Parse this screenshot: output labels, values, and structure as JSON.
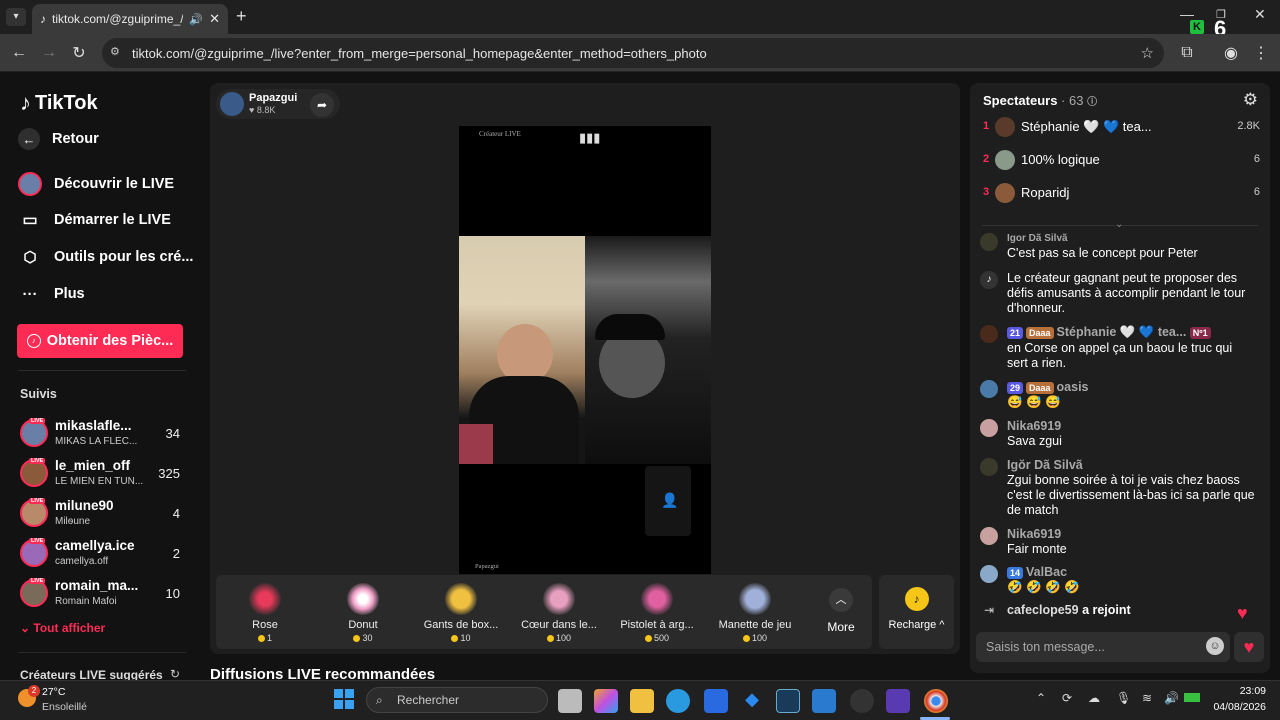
{
  "browser": {
    "tab_title": "tiktok.com/@zguiprime_/live",
    "url": "tiktok.com/@zguiprime_/live?enter_from_merge=personal_homepage&enter_method=others_photo",
    "overlay_number": "6"
  },
  "sidebar": {
    "logo": "TikTok",
    "back": "Retour",
    "nav": [
      "Découvrir le LIVE",
      "Démarrer le LIVE",
      "Outils pour les cré...",
      "Plus"
    ],
    "coin_button": "Obtenir des Pièc...",
    "following_title": "Suivis",
    "live_label": "LIVE",
    "following": [
      {
        "name": "mikaslafle...",
        "sub": "MIKAS LA FLÈC...",
        "count": "34",
        "color": "#6a7fa8"
      },
      {
        "name": "le_mien_off",
        "sub": "LE MIEN EN TUN...",
        "count": "325",
        "color": "#8a5a3a"
      },
      {
        "name": "milune90",
        "sub": "Milѳune",
        "count": "4",
        "color": "#b88a6a"
      },
      {
        "name": "camellya.ice",
        "sub": "camellya.off",
        "count": "2",
        "color": "#9a6ab8"
      },
      {
        "name": "romain_ma...",
        "sub": "Romain Mafoi",
        "count": "10",
        "color": "#7a6a5a"
      }
    ],
    "show_all": "Tout afficher",
    "suggested_title": "Créateurs LIVE suggérés"
  },
  "main": {
    "host_name": "Papazgui",
    "host_likes": "8.8K",
    "video_top_label": "Créateur LIVE",
    "video_bottom_label": "Papazgui",
    "gifts": [
      {
        "name": "Rose",
        "price": "1",
        "color": "#d4204a"
      },
      {
        "name": "Donut",
        "price": "30",
        "color": "#f0a0c8"
      },
      {
        "name": "Gants de box...",
        "price": "10",
        "color": "#f0c040"
      },
      {
        "name": "Cœur dans le...",
        "price": "100",
        "color": "#e8a0c0"
      },
      {
        "name": "Pistolet à arg...",
        "price": "500",
        "color": "#e060a0"
      },
      {
        "name": "Manette de jeu",
        "price": "100",
        "color": "#a0b0d8"
      }
    ],
    "more_label": "More",
    "recharge_label": "Recharge",
    "section_title": "Diffusions LIVE recommandées"
  },
  "chat": {
    "title": "Spectateurs",
    "viewer_count": "· 63",
    "ranking": [
      {
        "rank": "1",
        "name": "Stéphanie 🤍 💙 tea...",
        "value": "2.8K",
        "color": "#5a3a2a"
      },
      {
        "rank": "2",
        "name": "100% logique",
        "value": "6",
        "color": "#8a9a8a"
      },
      {
        "rank": "3",
        "name": "Roparidj",
        "value": "6",
        "color": "#8a5a3a"
      }
    ],
    "messages": [
      {
        "user": "Igor Dã Silvã",
        "text": "C'est pas sa le concept pour Peter",
        "color": "#3a3a2a",
        "badges": []
      },
      {
        "user": "",
        "text": "Le créateur gagnant peut te proposer des défis amusants à accomplir pendant le tour d'honneur.",
        "color": "#333333",
        "badges": []
      },
      {
        "user": "Stéphanie 🤍 💙 tea...",
        "text": "en Corse on appel ça un baou le truc qui sert a rien.",
        "color": "#4a2a1a",
        "badges": [
          "21",
          "Daaa",
          "Nº1"
        ]
      },
      {
        "user": "oasis",
        "text": "😅 😅 😅",
        "color": "#4a7aa8",
        "badges": [
          "29",
          "Daaa"
        ]
      },
      {
        "user": "Nika6919",
        "text": "Sava zgui",
        "color": "#c8a0a0",
        "badges": []
      },
      {
        "user": "Igŏr Dã Silvã",
        "text": "Zgui bonne soirée à toi je vais chez baoss c'est le divertissement là-bas ici sa parle que de match",
        "color": "#3a3a2a",
        "badges": []
      },
      {
        "user": "Nika6919",
        "text": "Fair monte",
        "color": "#c8a0a0",
        "badges": []
      },
      {
        "user": "ValBac",
        "text": "🤣 🤣 🤣 🤣",
        "color": "#8aa8c8",
        "badges": [
          "14"
        ]
      }
    ],
    "joined_user": "cafeclope59",
    "joined_text": "a rejoint",
    "input_placeholder": "Saisis ton message..."
  },
  "taskbar": {
    "weather_temp": "27°C",
    "weather_desc": "Ensoleillé",
    "weather_badge": "2",
    "search_placeholder": "Rechercher",
    "time": "23:09",
    "date": "04/08/2026"
  }
}
